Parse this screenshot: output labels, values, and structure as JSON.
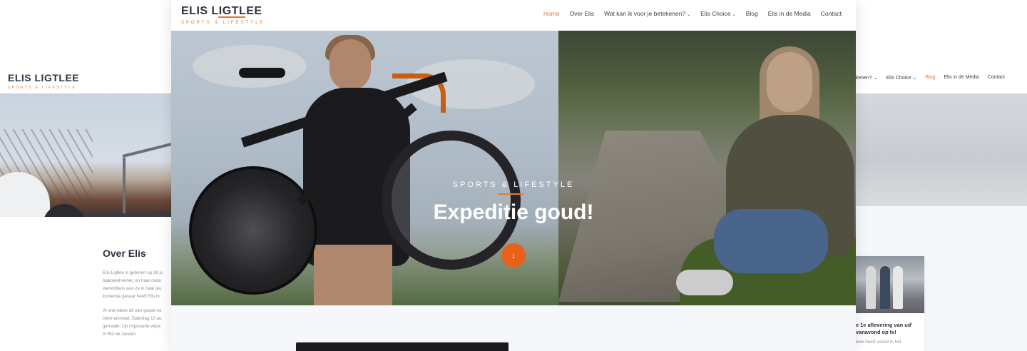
{
  "bg_left": {
    "logo": {
      "name": "ELIS LIGTLEE",
      "tagline": "SPORTS & LIFESTYLE"
    },
    "section_title": "Over Elis",
    "paragraphs": [
      "Elis Ligtlee is geboren op 28 ju",
      "baanwielrenner, en haar oude",
      "wereldtitels was ze in haar jeu",
      "komende gevaar heeft Elis in",
      "Al snel bleek dit een goede ke",
      "internationaal. Zaterdag 13 au",
      "gemaakt: Op imposante wijze",
      "in Rio de Janeiro."
    ]
  },
  "bg_right": {
    "nav": [
      "etekenen? ⌄",
      "Elis Choice ⌄",
      "Blog",
      "Elis in de Media",
      "Contact"
    ],
    "active_nav": "Blog",
    "card_title": "e 1e aflevering van ud' vanavond op tv!",
    "card_text": "leek heeft vooral in het"
  },
  "main": {
    "logo": {
      "name": "ELIS LIGTLEE",
      "tagline": "SPORTS & LIFESTYLE"
    },
    "menu": [
      {
        "label": "Home",
        "active": true,
        "dropdown": false
      },
      {
        "label": "Over Elis",
        "active": false,
        "dropdown": false
      },
      {
        "label": "Wat kan ik voor je betekenen?",
        "active": false,
        "dropdown": true
      },
      {
        "label": "Elis Choice",
        "active": false,
        "dropdown": true
      },
      {
        "label": "Blog",
        "active": false,
        "dropdown": false
      },
      {
        "label": "Elis in de Media",
        "active": false,
        "dropdown": false
      },
      {
        "label": "Contact",
        "active": false,
        "dropdown": false
      }
    ],
    "hero": {
      "kicker": "SPORTS & LIFESTYLE",
      "headline": "Expeditie goud!",
      "scroll_icon": "arrow-down-icon",
      "scroll_glyph": "↓"
    }
  },
  "colors": {
    "accent": "#e07a2e",
    "button": "#e8611a",
    "text_dark": "#2d3340"
  }
}
